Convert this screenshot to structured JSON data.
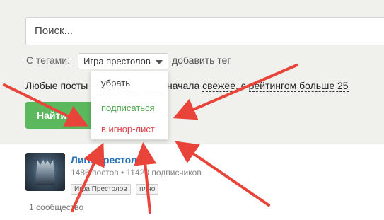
{
  "search": {
    "placeholder": "Поиск..."
  },
  "tags": {
    "label": "С тегами:",
    "selected": "Игра престолов",
    "add_label": "добавить тег"
  },
  "filter": {
    "prefix": "Любые посты",
    "middle": "начала",
    "sort_link": "свежее",
    "sep": ",  с",
    "rating_link": "рейтингом больше 25"
  },
  "find_button": "Найти посты",
  "dropdown": {
    "items": [
      {
        "label": "убрать",
        "color": "#333333"
      },
      {
        "label": "подписаться",
        "color": "#4ca64c"
      },
      {
        "label": "в игнор-лист",
        "color": "#e0424a"
      }
    ]
  },
  "community": {
    "name": "Лига Престолов",
    "posts": "1486 постов",
    "subscribers": "11420 подписчиков",
    "dot": "•",
    "tags": [
      "Игра Престолов",
      "пляо"
    ]
  },
  "result_count": "1 сообщество",
  "colors": {
    "arrow": "#e8443a",
    "accent_green": "#5cb85c",
    "link_blue": "#2a73b8"
  }
}
